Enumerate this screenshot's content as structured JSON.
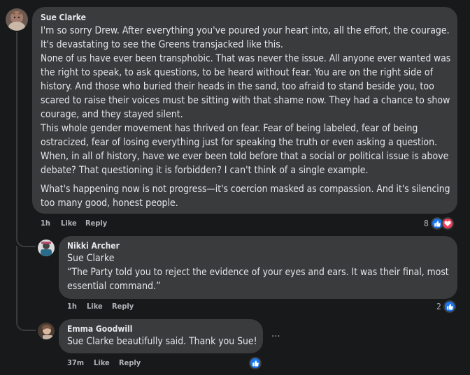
{
  "main_comment": {
    "author": "Sue Clarke",
    "paragraphs": [
      [
        "I'm so sorry Drew. After everything you've poured your heart into, all the effort, the courage.",
        "It's devastating to see the Greens transjacked like this."
      ],
      [
        "None of us have ever been transphobic. That was never the issue. All anyone ever wanted was",
        "the right to speak, to ask questions, to be heard without fear. You are on the right side of",
        "history. And those who buried their heads in the sand, too afraid to stand beside you, too",
        "scared to raise their voices must be sitting with that shame now. They had a chance to show",
        "courage, and they stayed silent."
      ],
      [
        "This whole gender movement has thrived on fear. Fear of being labeled, fear of being",
        "ostracized, fear of losing everything just for speaking the truth or even asking a question.",
        "When, in all of history, have we ever been told before that a social or political issue is above",
        "debate? That questioning it is forbidden? I can't think of a single example."
      ],
      [
        "What's happening now is not progress—it's coercion masked as compassion. And it's silencing",
        "too many good, honest people."
      ]
    ],
    "time": "1h",
    "like_label": "Like",
    "reply_label": "Reply",
    "reaction_count": "8",
    "reaction_types": [
      "like-icon",
      "love-icon"
    ]
  },
  "replies": [
    {
      "author": "Nikki Archer",
      "tag": "Sue Clarke",
      "lines": [
        "“The Party told you to reject the evidence of your eyes and ears. It was their final, most",
        "essential command.”"
      ],
      "time": "1h",
      "like_label": "Like",
      "reply_label": "Reply",
      "reaction_count": "2",
      "reaction_types": [
        "like-icon"
      ]
    },
    {
      "author": "Emma Goodwill",
      "lines": [
        "Sue Clarke beautifully said. Thank you Sue!"
      ],
      "time": "37m",
      "like_label": "Like",
      "reply_label": "Reply",
      "reaction_count": "",
      "reaction_types": [
        "like-icon"
      ],
      "more_label": "…"
    }
  ],
  "colors": {
    "background": "#18191a",
    "bubble": "#3a3b3c",
    "text": "#e4e6eb",
    "meta": "#b0b3b8",
    "like": "#1877f2",
    "love": "#f33e58"
  }
}
